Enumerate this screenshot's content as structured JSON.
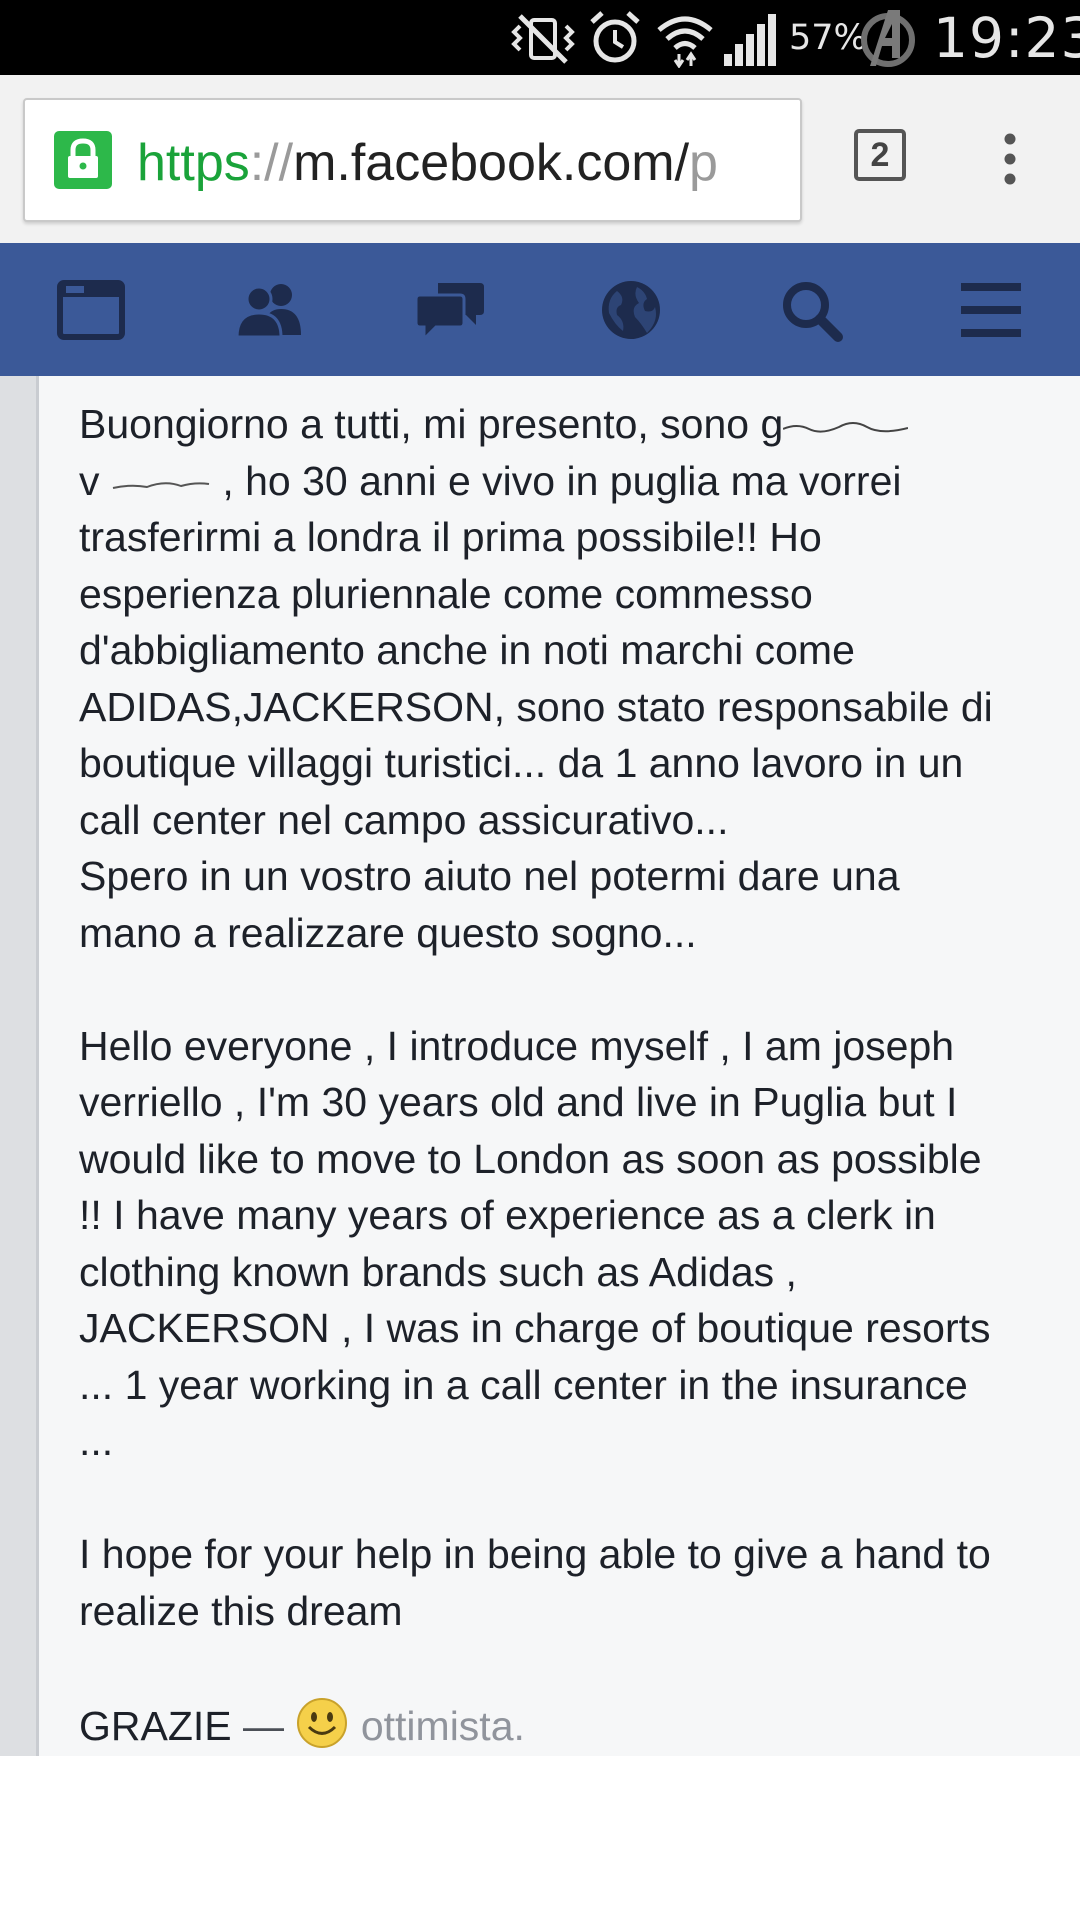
{
  "status_bar": {
    "battery": "57%",
    "time": "19:23",
    "icons": [
      "vibrate-muted-icon",
      "alarm-icon",
      "wifi-icon",
      "signal-icon",
      "avengers-logo-icon"
    ]
  },
  "browser": {
    "url_scheme": "https",
    "url_sep": "://",
    "url_host": "m.facebook.com/",
    "url_tail": "p",
    "tab_count": "2",
    "colors": {
      "lock": "#2db84a",
      "scheme": "#1aa33a"
    }
  },
  "fb_nav": {
    "color": "#3b5998",
    "items": [
      "news-feed-icon",
      "friends-icon",
      "messages-icon",
      "notifications-globe-icon",
      "search-icon",
      "menu-icon"
    ]
  },
  "post": {
    "lines_it": [
      "Buongiorno a tutti, mi presento, sono g",
      "v",
      ", ho 30 anni e vivo in puglia ma vorrei",
      "trasferirmi a londra il prima possibile!! Ho",
      "esperienza pluriennale come commesso",
      "d'abbigliamento anche in noti marchi come",
      "ADIDAS,JACKERSON, sono stato responsabile di",
      "boutique  villaggi turistici... da 1 anno lavoro in un",
      "call center nel campo assicurativo...",
      "Spero in un vostro aiuto nel potermi dare una",
      "mano a realizzare questo sogno..."
    ],
    "lines_en": [
      "Hello everyone , I introduce myself , I am joseph",
      "verriello , I'm 30 years old and live in Puglia but I",
      "would like to move to London as soon as possible",
      "!! I have many years of experience as a clerk in",
      "clothing known brands such as Adidas ,",
      "JACKERSON , I was in charge of boutique resorts",
      "... 1 year working in a call center in the insurance",
      "..."
    ],
    "lines_en2": [
      "I hope for your help in being able to give a hand to",
      "realize this dream"
    ],
    "closing": "GRAZIE",
    "dash": " — ",
    "feeling": "ottimista.",
    "feeling_icon": "smiley-face-icon"
  }
}
